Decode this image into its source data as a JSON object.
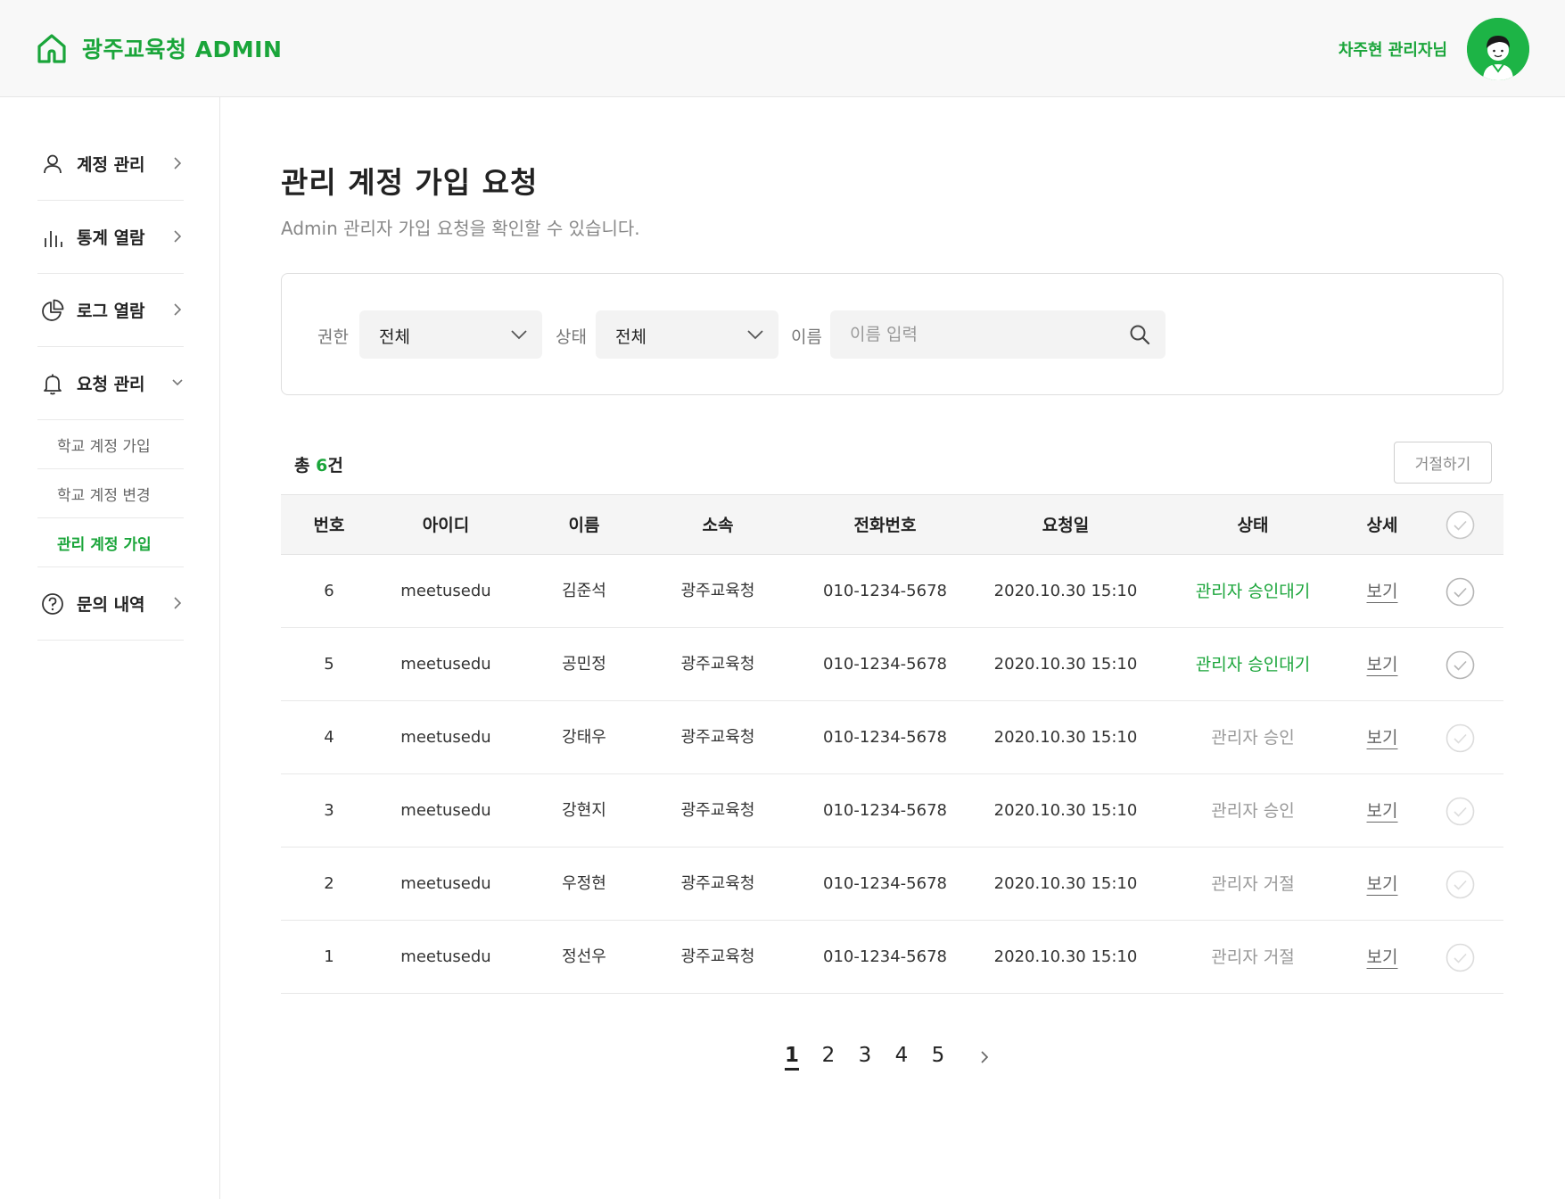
{
  "header": {
    "logo_text": "광주교육청 ADMIN",
    "user_name": "차주현 관리자님"
  },
  "sidebar": {
    "items": [
      {
        "label": "계정 관리",
        "icon": "user-icon"
      },
      {
        "label": "통계 열람",
        "icon": "bar-chart-icon"
      },
      {
        "label": "로그 열람",
        "icon": "pie-chart-icon"
      },
      {
        "label": "요청 관리",
        "icon": "bell-icon"
      },
      {
        "label": "문의 내역",
        "icon": "question-icon"
      }
    ],
    "subitems": [
      {
        "label": "학교 계정 가입"
      },
      {
        "label": "학교 계정 변경"
      },
      {
        "label": "관리 계정 가입"
      }
    ]
  },
  "page": {
    "title": "관리 계정 가입 요청",
    "subtitle": "Admin 관리자 가입 요청을 확인할 수 있습니다."
  },
  "filters": {
    "role_label": "권한",
    "role_value": "전체",
    "status_label": "상태",
    "status_value": "전체",
    "name_label": "이름",
    "name_placeholder": "이름 입력"
  },
  "summary": {
    "total_prefix": "총 ",
    "total_count": "6",
    "total_suffix": "건",
    "reject_label": "거절하기"
  },
  "table": {
    "headers": [
      "번호",
      "아이디",
      "이름",
      "소속",
      "전화번호",
      "요청일",
      "상태",
      "상세"
    ],
    "rows": [
      {
        "no": "6",
        "id": "meetusedu",
        "name": "김준석",
        "org": "광주교육청",
        "phone": "010-1234-5678",
        "date": "2020.10.30 15:10",
        "status": "관리자 승인대기",
        "detail": "보기"
      },
      {
        "no": "5",
        "id": "meetusedu",
        "name": "공민정",
        "org": "광주교육청",
        "phone": "010-1234-5678",
        "date": "2020.10.30 15:10",
        "status": "관리자 승인대기",
        "detail": "보기"
      },
      {
        "no": "4",
        "id": "meetusedu",
        "name": "강태우",
        "org": "광주교육청",
        "phone": "010-1234-5678",
        "date": "2020.10.30 15:10",
        "status": "관리자 승인",
        "detail": "보기"
      },
      {
        "no": "3",
        "id": "meetusedu",
        "name": "강현지",
        "org": "광주교육청",
        "phone": "010-1234-5678",
        "date": "2020.10.30 15:10",
        "status": "관리자 승인",
        "detail": "보기"
      },
      {
        "no": "2",
        "id": "meetusedu",
        "name": "우정현",
        "org": "광주교육청",
        "phone": "010-1234-5678",
        "date": "2020.10.30 15:10",
        "status": "관리자 거절",
        "detail": "보기"
      },
      {
        "no": "1",
        "id": "meetusedu",
        "name": "정선우",
        "org": "광주교육청",
        "phone": "010-1234-5678",
        "date": "2020.10.30 15:10",
        "status": "관리자 거절",
        "detail": "보기"
      }
    ]
  },
  "pagination": {
    "pages": [
      "1",
      "2",
      "3",
      "4",
      "5"
    ],
    "current": "1"
  },
  "colors": {
    "accent": "#1aa53a",
    "muted": "#999999"
  }
}
